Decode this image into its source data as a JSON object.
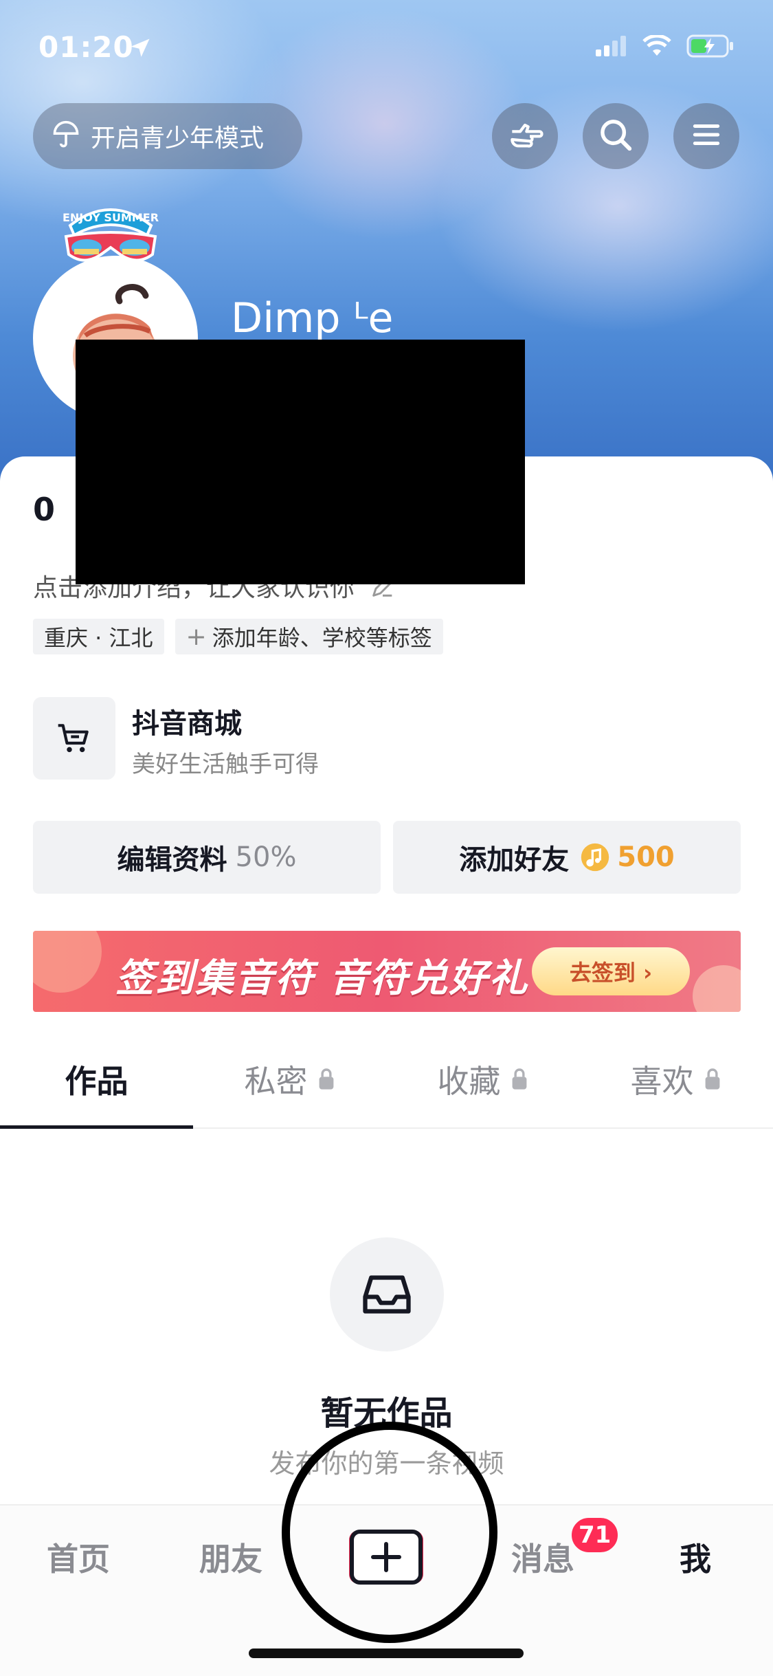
{
  "status_bar": {
    "time": "01:20"
  },
  "header": {
    "teen_mode_label": "开启青少年模式"
  },
  "profile": {
    "username": "Dimp ᴸe",
    "stats_prefix": "0",
    "bio_prompt": "点击添加介绍，让大家认识你",
    "tags": [
      "重庆 · 江北",
      "添加年龄、学校等标签"
    ],
    "sticker_text": "ENJOY SUMMER"
  },
  "shop": {
    "title": "抖音商城",
    "subtitle": "美好生活触手可得"
  },
  "actions": {
    "edit_label": "编辑资料",
    "edit_percent": "50%",
    "add_friend_label": "添加好友",
    "add_friend_reward": "500"
  },
  "banner": {
    "text": "签到集音符 音符兑好礼",
    "button": "去签到 ›"
  },
  "tabs": [
    {
      "label": "作品",
      "locked": false
    },
    {
      "label": "私密",
      "locked": true
    },
    {
      "label": "收藏",
      "locked": true
    },
    {
      "label": "喜欢",
      "locked": true
    }
  ],
  "empty_state": {
    "title": "暂无作品",
    "subtitle": "发布你的第一条视频"
  },
  "tabbar": {
    "items": [
      "首页",
      "朋友",
      "消息",
      "我"
    ],
    "message_badge": "71"
  },
  "colors": {
    "accent": "#fe2c55",
    "reward": "#f0a030"
  }
}
